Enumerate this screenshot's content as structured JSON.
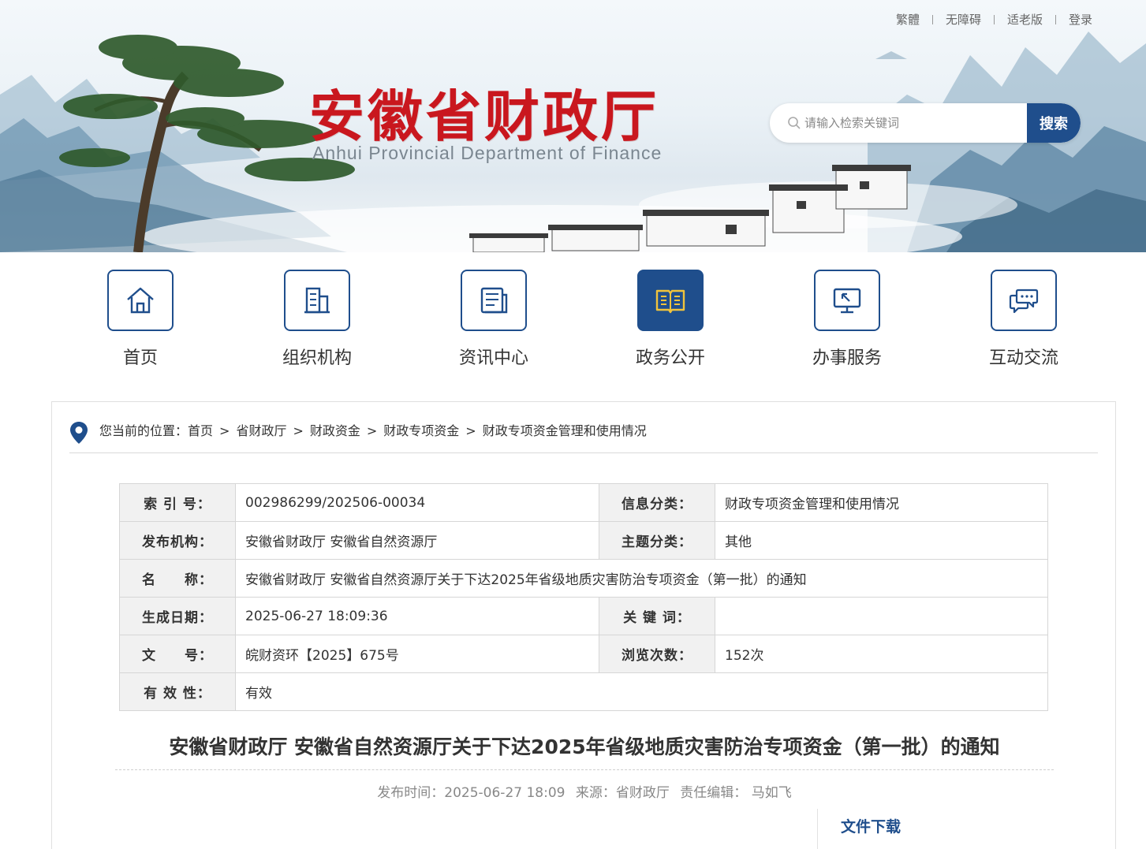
{
  "header": {
    "top_links": [
      "繁體",
      "无障碍",
      "适老版",
      "登录"
    ],
    "title_cn": "安徽省财政厅",
    "title_en": "Anhui Provincial Department of Finance",
    "search": {
      "placeholder": "请输入检索关键词",
      "button": "搜索"
    }
  },
  "nav": {
    "items": [
      {
        "label": "首页",
        "icon": "home-icon"
      },
      {
        "label": "组织机构",
        "icon": "building-icon"
      },
      {
        "label": "资讯中心",
        "icon": "news-icon"
      },
      {
        "label": "政务公开",
        "icon": "open-book-icon",
        "active": true
      },
      {
        "label": "办事服务",
        "icon": "monitor-click-icon"
      },
      {
        "label": "互动交流",
        "icon": "chat-icon"
      }
    ]
  },
  "breadcrumb": {
    "prefix": "您当前的位置：",
    "items": [
      "首页",
      "省财政厅",
      "财政资金",
      "财政专项资金",
      "财政专项资金管理和使用情况"
    ],
    "separator": ">"
  },
  "meta": {
    "index_no": {
      "label": "索 引 号：",
      "value": "002986299/202506-00034"
    },
    "info_category": {
      "label": "信息分类：",
      "value": "财政专项资金管理和使用情况"
    },
    "publisher": {
      "label": "发布机构：",
      "value": "安徽省财政厅 安徽省自然资源厅"
    },
    "topic_category": {
      "label": "主题分类：",
      "value": "其他"
    },
    "name": {
      "label": "名　　称：",
      "value": "安徽省财政厅 安徽省自然资源厅关于下达2025年省级地质灾害防治专项资金（第一批）的通知"
    },
    "created": {
      "label": "生成日期：",
      "value": "2025-06-27 18:09:36"
    },
    "keywords": {
      "label": "关 键 词：",
      "value": ""
    },
    "doc_no": {
      "label": "文　　号：",
      "value": "皖财资环【2025】675号"
    },
    "views": {
      "label": "浏览次数：",
      "value": "152次"
    },
    "validity": {
      "label": "有 效 性：",
      "value": "有效"
    }
  },
  "article": {
    "title": "安徽省财政厅 安徽省自然资源厅关于下达2025年省级地质灾害防治专项资金（第一批）的通知",
    "publish_time": "发布时间：2025-06-27 18:09",
    "source": "来源：省财政厅",
    "editor": "责任编辑： 马如飞",
    "download_title": "文件下载"
  },
  "colors": {
    "brand_blue": "#1f4e8c",
    "logo_red": "#c9171e"
  }
}
